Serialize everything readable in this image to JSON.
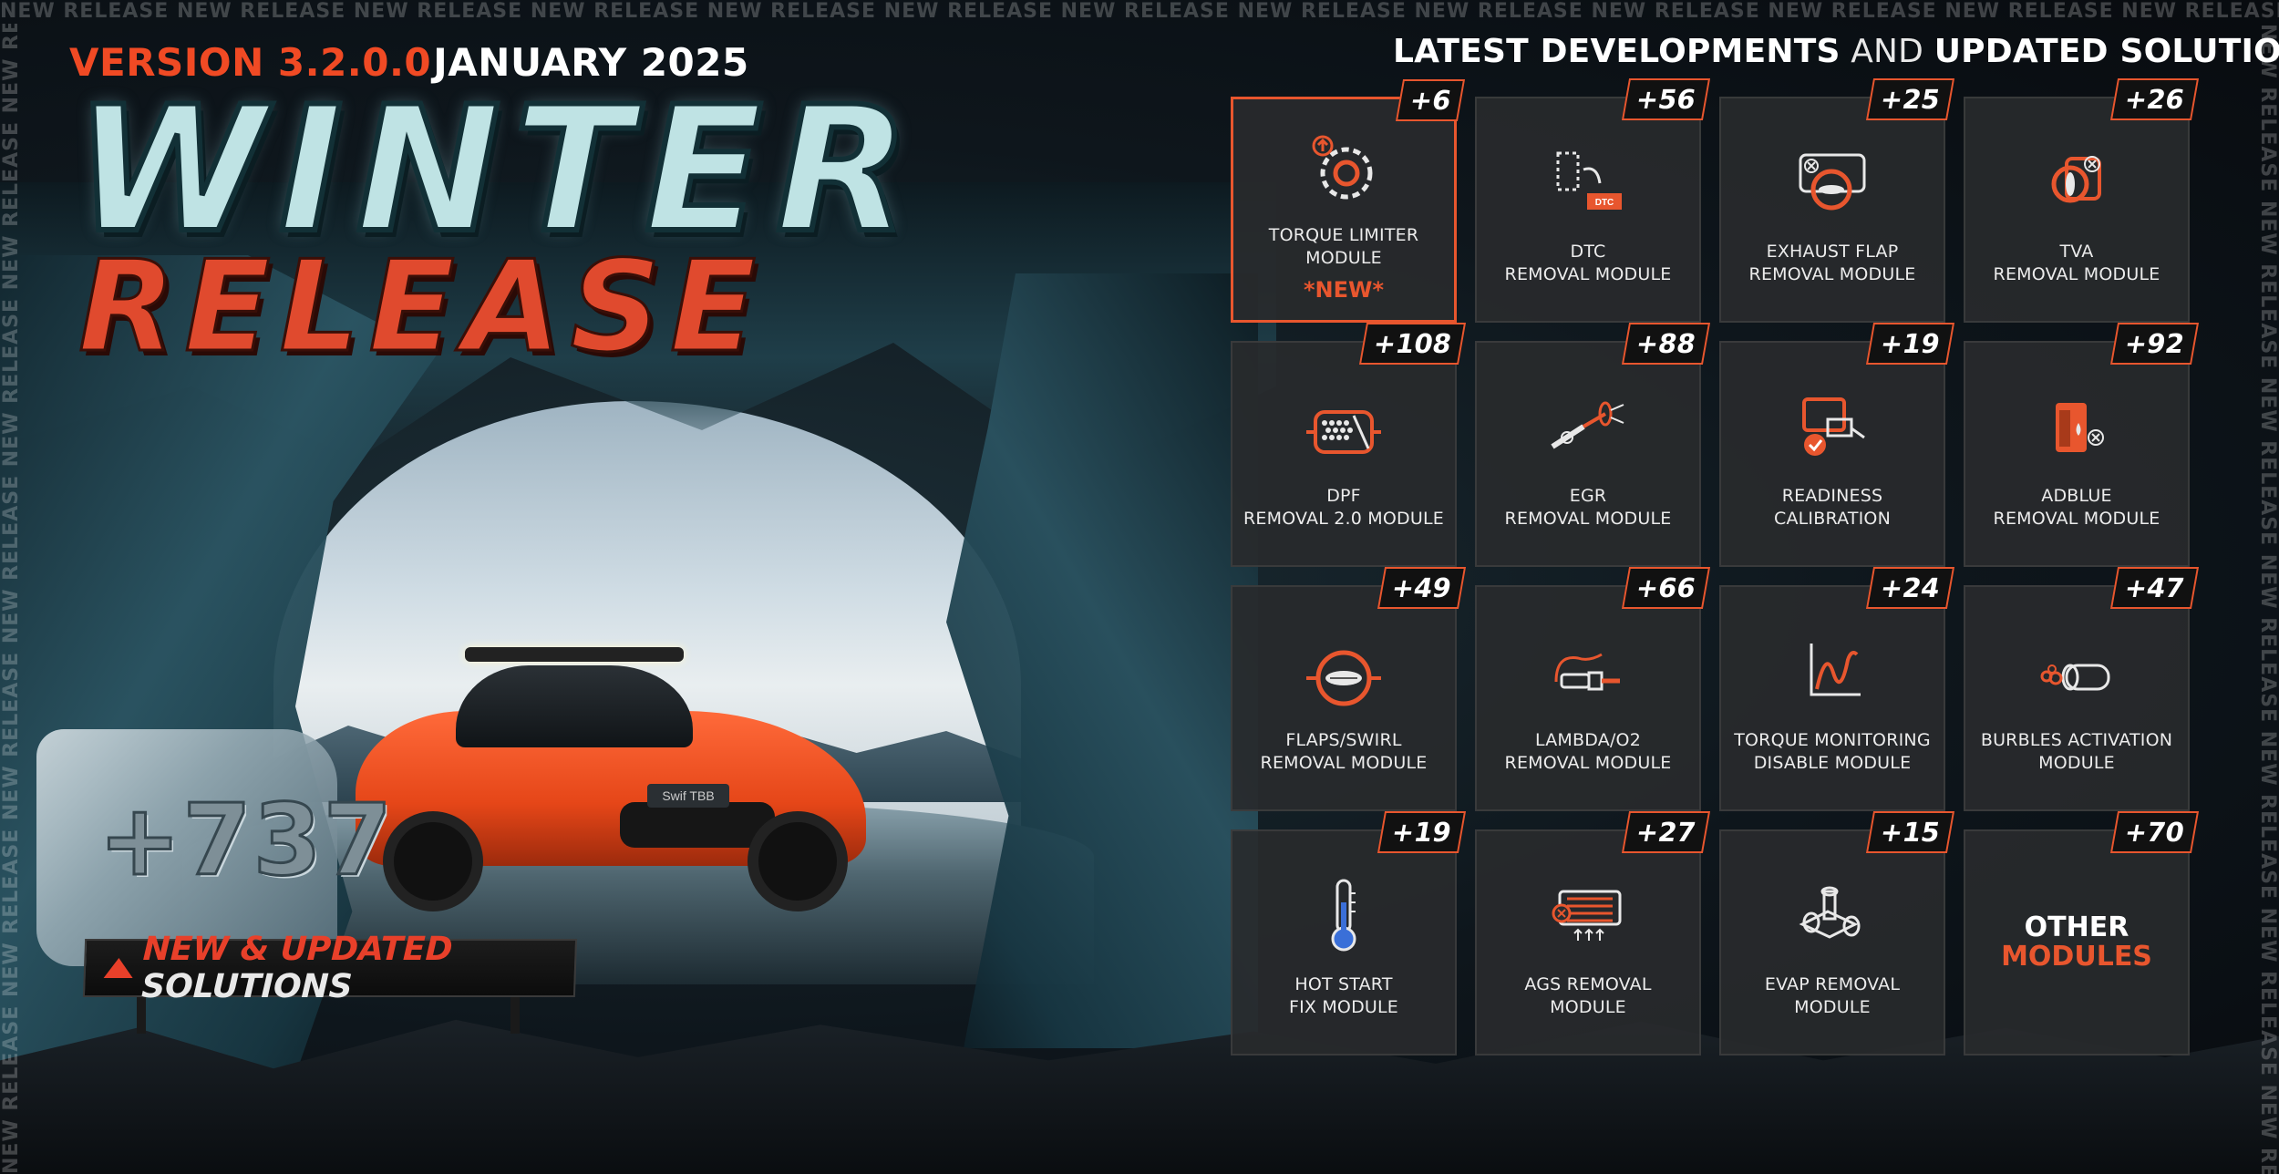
{
  "border": {
    "text": "NEW RELEASE NEW RELEASE NEW RELEASE NEW RELEASE NEW RELEASE NEW RELEASE NEW RELEASE NEW RELEASE NEW RELEASE NEW RELEASE NEW RELEASE NEW RELEASE NEW RELEASE NEW RELEASE NEW RELEASE NEW RELEASE NEW RELEASE NEW RELEASE NEW RELEASE NEW RELEASE NEW RELEASE NEW RELEASE NEW RELEASE NEW RELEASE NEW RELEASE NEW RELEASE NEW RELEASE"
  },
  "header": {
    "version": "VERSION 3.2.0.0",
    "date": "JANUARY 2025",
    "title_line1": "WINTER",
    "title_line2": "RELEASE"
  },
  "promo": {
    "ice_number": "+737",
    "sign_highlight": "NEW & UPDATED",
    "sign_rest": " SOLUTIONS",
    "plate": "Swif TBB"
  },
  "panel": {
    "heading_bold1": "LATEST DEVELOPMENTS",
    "heading_light": " AND ",
    "heading_bold2": "UPDATED SOLUTIONS"
  },
  "modules": [
    {
      "badge": "+6",
      "label": "TORQUE LIMITER\nMODULE",
      "icon": "torque-limiter-icon",
      "new": "*NEW*"
    },
    {
      "badge": "+56",
      "label": "DTC\nREMOVAL MODULE",
      "icon": "dtc-icon"
    },
    {
      "badge": "+25",
      "label": "EXHAUST FLAP\nREMOVAL MODULE",
      "icon": "exhaust-flap-icon"
    },
    {
      "badge": "+26",
      "label": "TVA\nREMOVAL MODULE",
      "icon": "tva-icon"
    },
    {
      "badge": "+108",
      "label": "DPF\nREMOVAL 2.0 MODULE",
      "icon": "dpf-icon"
    },
    {
      "badge": "+88",
      "label": "EGR\nREMOVAL MODULE",
      "icon": "egr-icon"
    },
    {
      "badge": "+19",
      "label": "READINESS\nCALIBRATION",
      "icon": "readiness-icon"
    },
    {
      "badge": "+92",
      "label": "ADBLUE\nREMOVAL MODULE",
      "icon": "adblue-icon"
    },
    {
      "badge": "+49",
      "label": "FLAPS/SWIRL\nREMOVAL MODULE",
      "icon": "flaps-swirl-icon"
    },
    {
      "badge": "+66",
      "label": "LAMBDA/O2\nREMOVAL MODULE",
      "icon": "lambda-icon"
    },
    {
      "badge": "+24",
      "label": "TORQUE MONITORING\nDISABLE MODULE",
      "icon": "torque-monitoring-icon"
    },
    {
      "badge": "+47",
      "label": "BURBLES ACTIVATION\nMODULE",
      "icon": "burbles-icon"
    },
    {
      "badge": "+19",
      "label": "HOT START\nFIX MODULE",
      "icon": "thermometer-icon"
    },
    {
      "badge": "+27",
      "label": "AGS REMOVAL\nMODULE",
      "icon": "ags-icon"
    },
    {
      "badge": "+15",
      "label": "EVAP REMOVAL\nMODULE",
      "icon": "evap-icon"
    },
    {
      "badge": "+70",
      "other_line1": "OTHER",
      "other_line2": "MODULES"
    }
  ],
  "colors": {
    "accent": "#e8562e",
    "card_bg": "#2a2c2e",
    "title_ice": "#bfe3e4",
    "title_red": "#e04a2e"
  }
}
